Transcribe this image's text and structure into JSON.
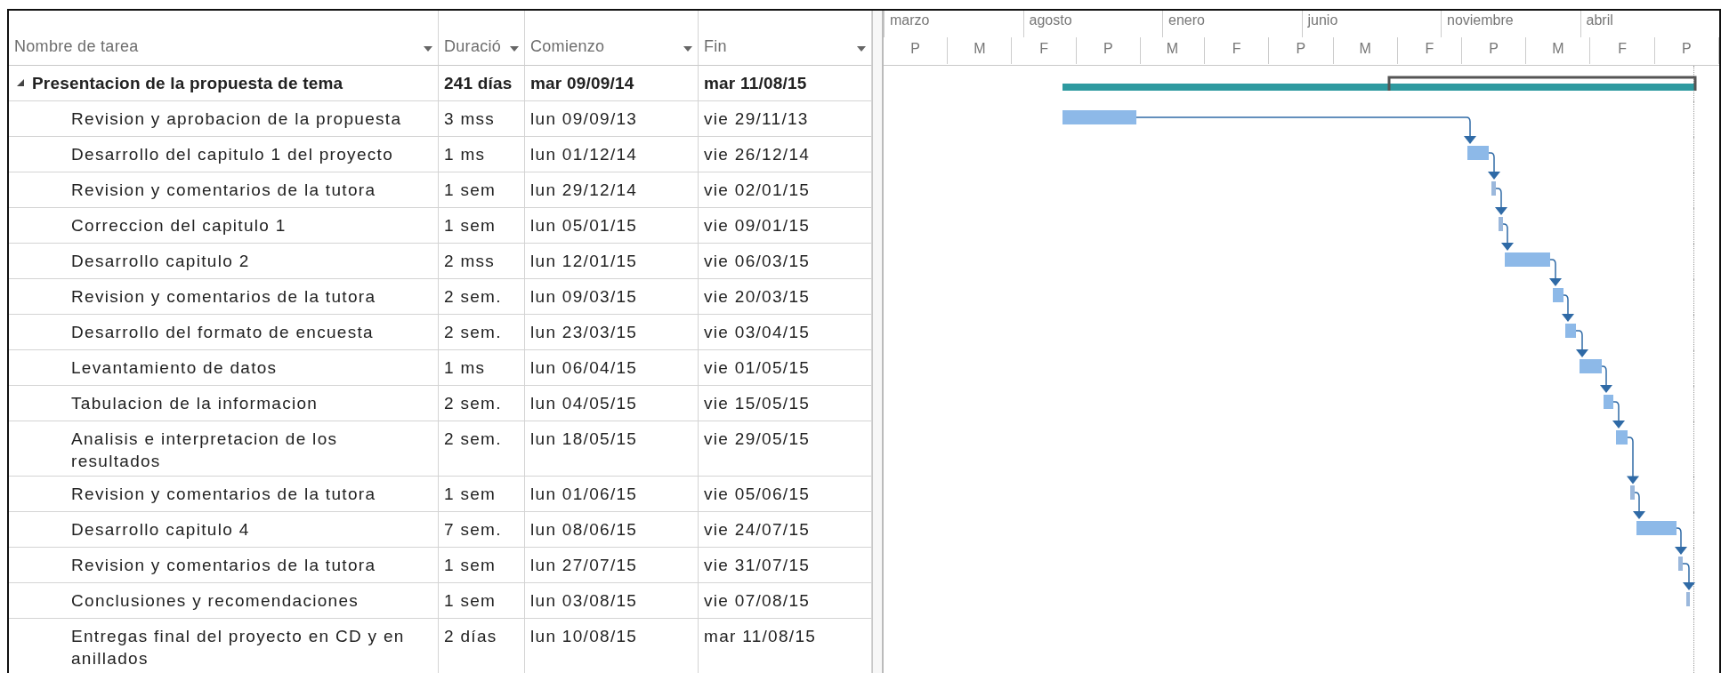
{
  "columns": [
    {
      "label": "Nombre de tarea"
    },
    {
      "label": "Duració"
    },
    {
      "label": "Comienzo"
    },
    {
      "label": "Fin"
    }
  ],
  "timescale": {
    "top": [
      "marzo",
      "agosto",
      "enero",
      "junio",
      "noviembre",
      "abril"
    ],
    "bottom": [
      "P",
      "M",
      "F",
      "P",
      "M",
      "F",
      "P",
      "M",
      "F",
      "P",
      "M",
      "F",
      "P"
    ]
  },
  "tasks": [
    {
      "name": "Presentacion de la propuesta de tema",
      "duration": "241 días",
      "start": "mar 09/09/14",
      "finish": "mar 11/08/15",
      "expanded": true,
      "children": [
        {
          "name": "Revision y aprobacion de la propuesta",
          "duration": "3 mss",
          "start": "lun 09/09/13",
          "finish": "vie 29/11/13"
        },
        {
          "name": "Desarrollo del capitulo 1 del proyecto",
          "duration": "1 ms",
          "start": "lun 01/12/14",
          "finish": "vie 26/12/14"
        },
        {
          "name": "Revision y comentarios de la tutora",
          "duration": "1 sem",
          "start": "lun 29/12/14",
          "finish": "vie 02/01/15"
        },
        {
          "name": "Correccion del capitulo 1",
          "duration": "1 sem",
          "start": "lun 05/01/15",
          "finish": "vie 09/01/15"
        },
        {
          "name": "Desarrollo capitulo 2",
          "duration": "2 mss",
          "start": "lun 12/01/15",
          "finish": "vie 06/03/15"
        },
        {
          "name": "Revision y comentarios de la tutora",
          "duration": "2 sem.",
          "start": "lun 09/03/15",
          "finish": "vie 20/03/15"
        },
        {
          "name": "Desarrollo del formato de encuesta",
          "duration": "2 sem.",
          "start": "lun 23/03/15",
          "finish": "vie 03/04/15"
        },
        {
          "name": "Levantamiento de datos",
          "duration": "1 ms",
          "start": "lun 06/04/15",
          "finish": "vie 01/05/15"
        },
        {
          "name": "Tabulacion de la informacion",
          "duration": "2 sem.",
          "start": "lun 04/05/15",
          "finish": "vie 15/05/15"
        },
        {
          "name": "Analisis e interpretacion de los resultados",
          "duration": "2 sem.",
          "start": "lun 18/05/15",
          "finish": "vie 29/05/15"
        },
        {
          "name": "Revision y comentarios de la tutora",
          "duration": "1 sem",
          "start": "lun 01/06/15",
          "finish": "vie 05/06/15"
        },
        {
          "name": "Desarrollo capitulo 4",
          "duration": "7 sem.",
          "start": "lun 08/06/15",
          "finish": "vie 24/07/15"
        },
        {
          "name": "Revision y comentarios de la tutora",
          "duration": "1 sem",
          "start": "lun 27/07/15",
          "finish": "vie 31/07/15"
        },
        {
          "name": "Conclusiones y recomendaciones",
          "duration": "1 sem",
          "start": "lun 03/08/15",
          "finish": "vie 07/08/15"
        },
        {
          "name": "Entregas final del proyecto en CD y en anillados",
          "duration": "2 días",
          "start": "lun 10/08/15",
          "finish": "mar 11/08/15"
        }
      ]
    }
  ]
}
